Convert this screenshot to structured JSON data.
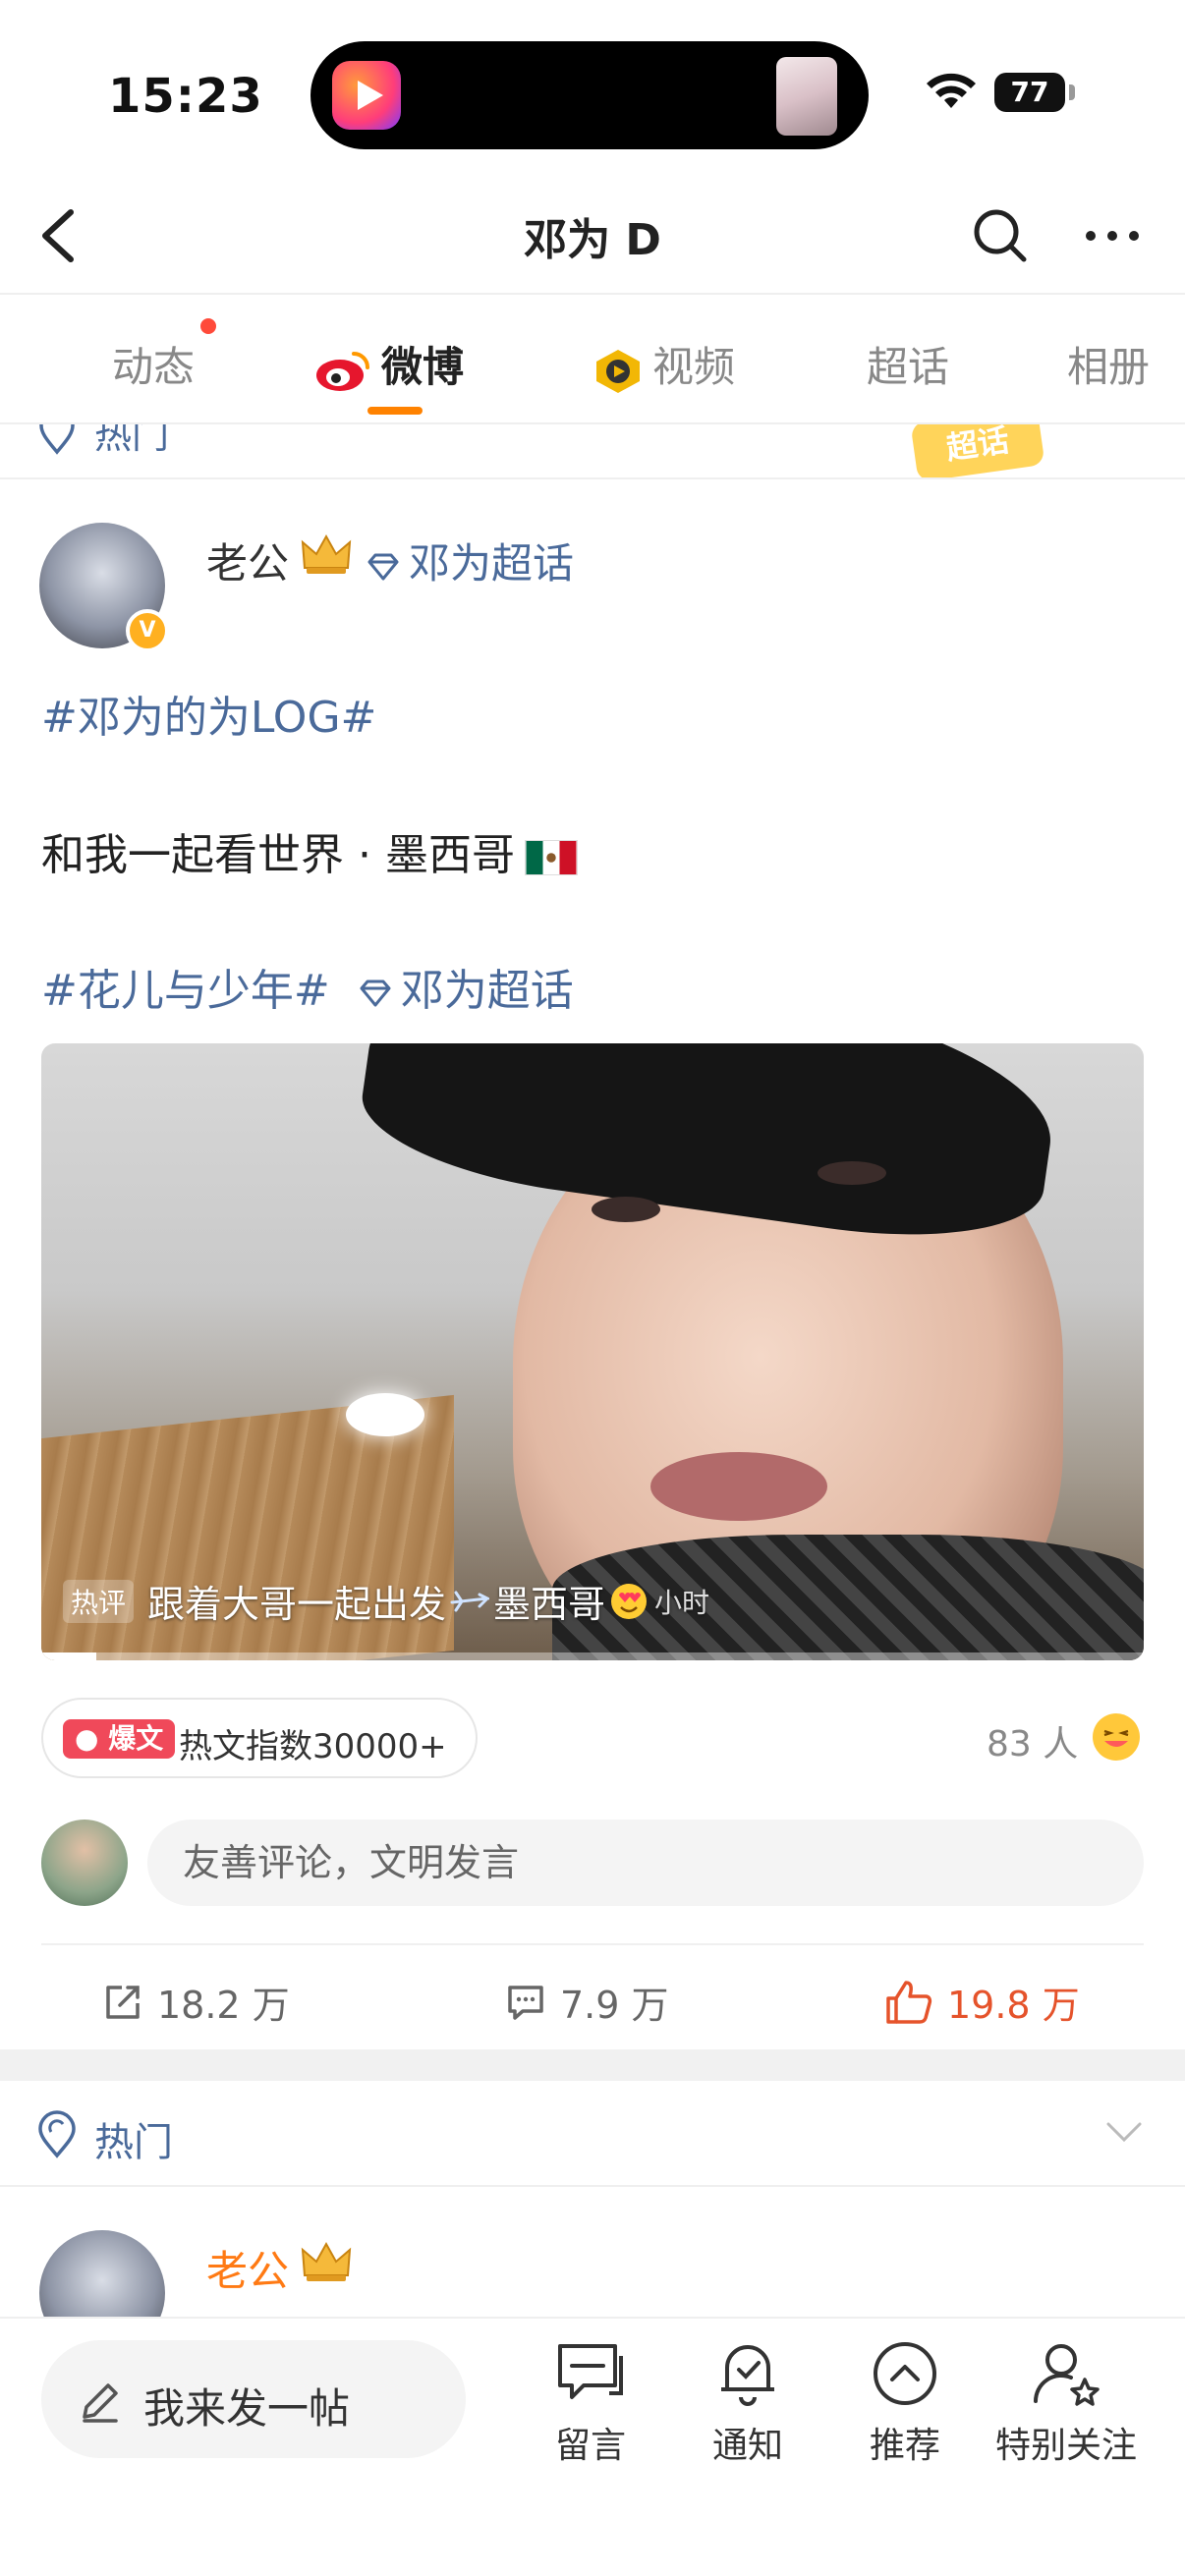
{
  "status_bar": {
    "time": "15:23",
    "battery": "77"
  },
  "nav": {
    "title": "邓为 D"
  },
  "tabs": [
    {
      "label": "动态"
    },
    {
      "label": "微博"
    },
    {
      "label": "视频"
    },
    {
      "label": "超话"
    },
    {
      "label": "相册"
    }
  ],
  "peek": {
    "text": "热门",
    "badge": "超话"
  },
  "post": {
    "author": "老公",
    "supertopic_tag": "邓为超话",
    "hashtag_top": "#邓为的为LOG#",
    "body": "和我一起看世界 · 墨西哥",
    "hashtag_bottom": "#花儿与少年#",
    "hashtag_bottom_link": "邓为超话",
    "video": {
      "tag": "热评",
      "caption": "跟着大哥一起出发",
      "caption_tail": "墨西哥",
      "time_suffix": "小时",
      "progress": 0.05
    },
    "hot_badge": "爆文",
    "hot_index": "热文指数30000+",
    "viewers": "83 人",
    "comment_placeholder": "友善评论，文明发言",
    "actions": {
      "repost": "18.2 万",
      "comments": "7.9 万",
      "likes": "19.8 万"
    }
  },
  "second_card": {
    "header": "热门",
    "author": "老公"
  },
  "bottom_bar": {
    "compose": "我来发一帖",
    "items": [
      {
        "label": "留言"
      },
      {
        "label": "通知"
      },
      {
        "label": "推荐"
      },
      {
        "label": "特别关注"
      }
    ]
  },
  "colors": {
    "accent": "#ff8200",
    "link": "#4a6a9a",
    "like": "#e5532b",
    "hot": "#f0495a"
  }
}
